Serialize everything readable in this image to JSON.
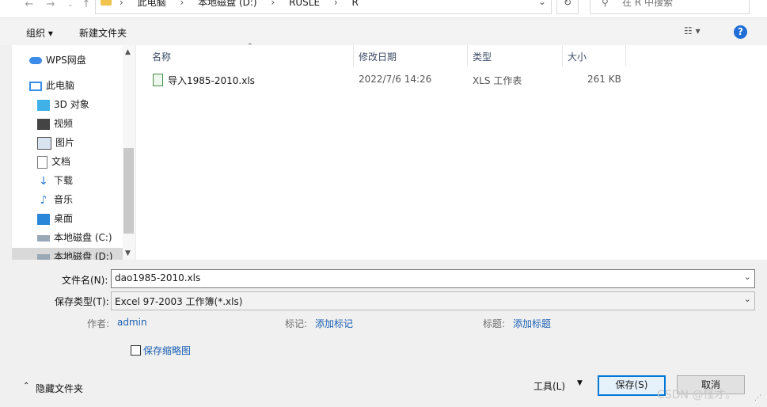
{
  "address": {
    "crumbs": [
      "此电脑",
      "本地磁盘 (D:)",
      "RUSLE",
      "R"
    ],
    "search_placeholder": "在 R 中搜索"
  },
  "toolbar": {
    "organize": "组织 ▾",
    "new_folder": "新建文件夹"
  },
  "nav": {
    "items": [
      {
        "label": "WPS网盘",
        "icon": "cloud-icon"
      },
      {
        "label": "此电脑",
        "icon": "computer-icon"
      },
      {
        "label": "3D 对象",
        "icon": "3d-objects-icon"
      },
      {
        "label": "视频",
        "icon": "video-icon"
      },
      {
        "label": "图片",
        "icon": "picture-icon"
      },
      {
        "label": "文档",
        "icon": "document-icon"
      },
      {
        "label": "下载",
        "icon": "download-icon"
      },
      {
        "label": "音乐",
        "icon": "music-icon"
      },
      {
        "label": "桌面",
        "icon": "desktop-icon"
      },
      {
        "label": "本地磁盘 (C:)",
        "icon": "drive-icon"
      },
      {
        "label": "本地磁盘 (D:)",
        "icon": "drive-icon"
      }
    ]
  },
  "columns": {
    "name": "名称",
    "modified": "修改日期",
    "type": "类型",
    "size": "大小"
  },
  "files": [
    {
      "name": "导入1985-2010.xls",
      "modified": "2022/7/6 14:26",
      "type": "XLS 工作表",
      "size": "261 KB"
    }
  ],
  "form": {
    "filename_label": "文件名(N):",
    "filename_value": "dao1985-2010.xls",
    "type_label": "保存类型(T):",
    "type_value": "Excel 97-2003 工作簿(*.xls)",
    "author_label": "作者:",
    "author_value": "admin",
    "tags_label": "标记:",
    "tags_value": "添加标记",
    "title_label": "标题:",
    "title_value": "添加标题",
    "save_thumbnail": "保存缩略图"
  },
  "footer": {
    "hide_folders": "隐藏文件夹",
    "tools": "工具(L)",
    "save": "保存(S)",
    "cancel": "取消"
  },
  "watermark": "CSDN @怪才。"
}
